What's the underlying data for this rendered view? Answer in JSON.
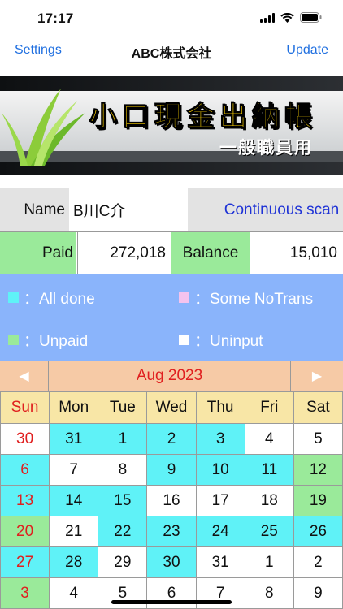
{
  "status": {
    "time": "17:17"
  },
  "nav": {
    "left": "Settings",
    "title": "ABC株式会社",
    "right": "Update"
  },
  "banner": {
    "title": "小口現金出納帳",
    "subtitle": "一般職員用"
  },
  "info": {
    "name_label": "Name",
    "name_value": "B川C介",
    "continuous_scan": "Continuous scan",
    "paid_label": "Paid",
    "paid_value": "272,018",
    "balance_label": "Balance",
    "balance_value": "15,010"
  },
  "legend": [
    {
      "color": "#5ff2f7",
      "label": "：All done"
    },
    {
      "color": "#f5c3ee",
      "label": "：Some NoTrans"
    },
    {
      "color": "#9aea9a",
      "label": "：Unpaid"
    },
    {
      "color": "#ffffff",
      "label": "：Uninput"
    }
  ],
  "calendar": {
    "prev": "◀",
    "next": "▶",
    "month": "Aug 2023",
    "weekdays": [
      "Sun",
      "Mon",
      "Tue",
      "Wed",
      "Thu",
      "Fri",
      "Sat"
    ],
    "weeks": [
      [
        {
          "d": "30",
          "s": "white"
        },
        {
          "d": "31",
          "s": "cyan"
        },
        {
          "d": "1",
          "s": "cyan"
        },
        {
          "d": "2",
          "s": "cyan"
        },
        {
          "d": "3",
          "s": "cyan"
        },
        {
          "d": "4",
          "s": "white"
        },
        {
          "d": "5",
          "s": "white"
        }
      ],
      [
        {
          "d": "6",
          "s": "cyan"
        },
        {
          "d": "7",
          "s": "white"
        },
        {
          "d": "8",
          "s": "white"
        },
        {
          "d": "9",
          "s": "cyan"
        },
        {
          "d": "10",
          "s": "cyan"
        },
        {
          "d": "11",
          "s": "cyan"
        },
        {
          "d": "12",
          "s": "green"
        }
      ],
      [
        {
          "d": "13",
          "s": "cyan"
        },
        {
          "d": "14",
          "s": "cyan"
        },
        {
          "d": "15",
          "s": "cyan"
        },
        {
          "d": "16",
          "s": "white"
        },
        {
          "d": "17",
          "s": "white"
        },
        {
          "d": "18",
          "s": "white"
        },
        {
          "d": "19",
          "s": "green"
        }
      ],
      [
        {
          "d": "20",
          "s": "green"
        },
        {
          "d": "21",
          "s": "white"
        },
        {
          "d": "22",
          "s": "cyan"
        },
        {
          "d": "23",
          "s": "cyan"
        },
        {
          "d": "24",
          "s": "cyan"
        },
        {
          "d": "25",
          "s": "cyan"
        },
        {
          "d": "26",
          "s": "cyan"
        }
      ],
      [
        {
          "d": "27",
          "s": "cyan"
        },
        {
          "d": "28",
          "s": "cyan"
        },
        {
          "d": "29",
          "s": "white"
        },
        {
          "d": "30",
          "s": "cyan"
        },
        {
          "d": "31",
          "s": "white"
        },
        {
          "d": "1",
          "s": "white"
        },
        {
          "d": "2",
          "s": "white"
        }
      ],
      [
        {
          "d": "3",
          "s": "green"
        },
        {
          "d": "4",
          "s": "white"
        },
        {
          "d": "5",
          "s": "white"
        },
        {
          "d": "6",
          "s": "white"
        },
        {
          "d": "7",
          "s": "white"
        },
        {
          "d": "8",
          "s": "white"
        },
        {
          "d": "9",
          "s": "white"
        }
      ]
    ]
  }
}
